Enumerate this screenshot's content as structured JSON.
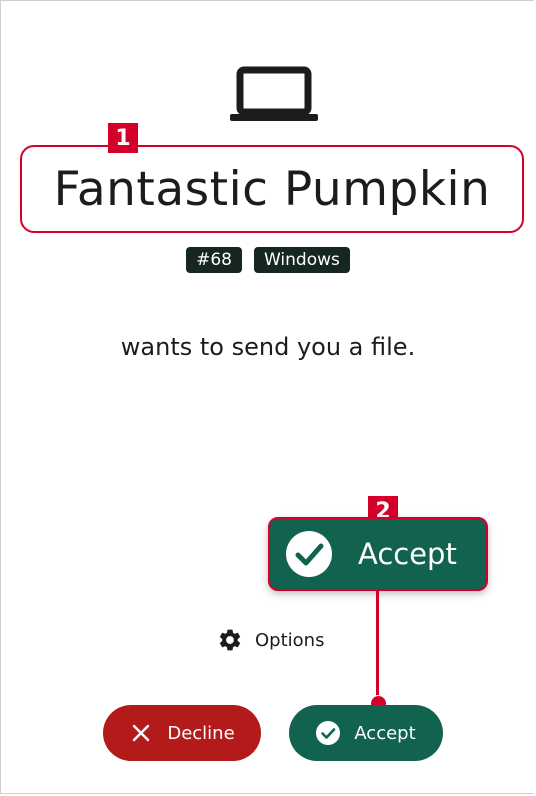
{
  "device": {
    "icon": "laptop-icon",
    "name": "Fantastic Pumpkin",
    "tags": [
      "#68",
      "Windows"
    ]
  },
  "message": "wants to send you a file.",
  "callouts": {
    "one": "1",
    "two": "2"
  },
  "zoomed_accept": {
    "icon": "check-circle-icon",
    "label": "Accept"
  },
  "options": {
    "icon": "gear-icon",
    "label": "Options"
  },
  "actions": {
    "decline": {
      "icon": "close-icon",
      "label": "Decline",
      "color": "#b31b1b"
    },
    "accept": {
      "icon": "check-circle-icon",
      "label": "Accept",
      "color": "#116350"
    }
  },
  "colors": {
    "callout": "#d4002a",
    "tag_bg": "#15271f"
  }
}
